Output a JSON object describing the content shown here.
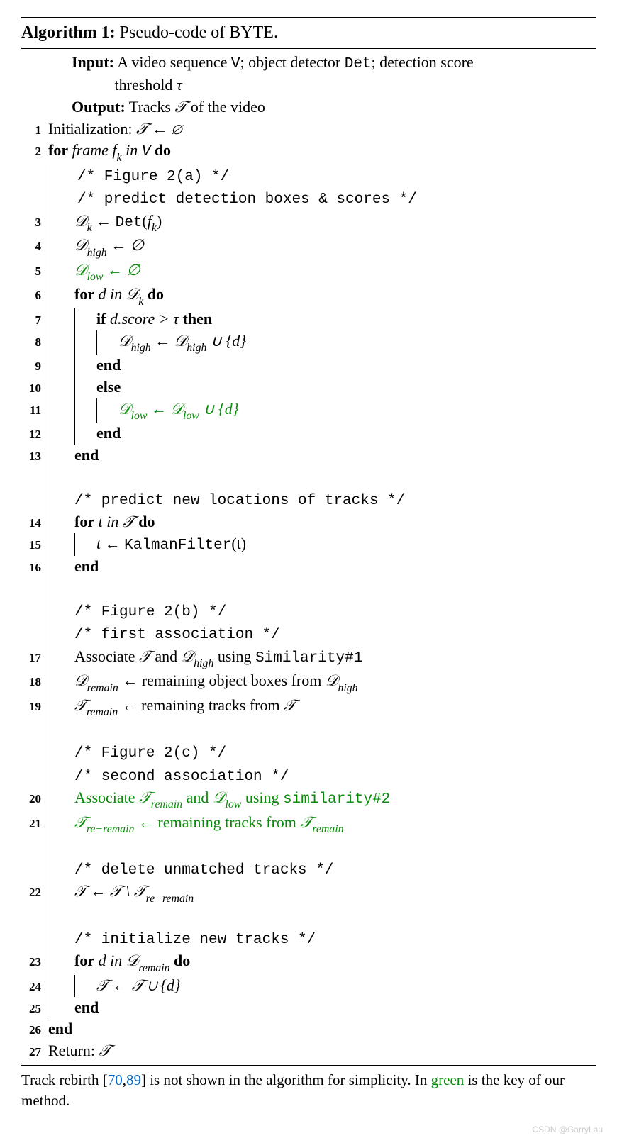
{
  "title_prefix": "Algorithm 1:",
  "title_text": " Pseudo-code of BYTE.",
  "input_label": "Input:",
  "input_text_1": " A video sequence ",
  "input_v": "V",
  "input_text_2": "; object detector ",
  "input_det": "Det",
  "input_text_3": "; detection score",
  "input_text_4": "threshold ",
  "input_tau": "τ",
  "output_label": "Output:",
  "output_text_1": " Tracks ",
  "output_T": "𝒯",
  "output_text_2": " of the video",
  "l1_text": "Initialization: ",
  "l1_assign": "𝒯 ← ∅",
  "l2_for": "for",
  "l2_frame": " frame f",
  "l2_k": "k",
  "l2_in": " in ",
  "l2_V": "V",
  "l2_do": " do",
  "c_fig2a": "/* Figure 2(a) */",
  "c_predict_boxes": "/* predict detection boxes & scores */",
  "l3_Dk": "𝒟",
  "l3_k": "k",
  "l3_arrow": " ← ",
  "l3_det": "Det",
  "l3_paren_open": "(",
  "l3_f": "f",
  "l3_fk": "k",
  "l3_paren_close": ")",
  "l4_Dhigh": "𝒟",
  "l4_high": "high",
  "l4_rest": " ← ∅",
  "l5_Dlow": "𝒟",
  "l5_low": "low",
  "l5_rest": " ← ∅",
  "l6_for": "for",
  "l6_d": " d ",
  "l6_in": "in",
  "l6_Dk": " 𝒟",
  "l6_k": "k",
  "l6_do": " do",
  "l7_if": "if",
  "l7_cond": " d.score > τ ",
  "l7_then": "then",
  "l8_Dhigh1": "𝒟",
  "l8_high1": "high",
  "l8_arrow": " ← ",
  "l8_Dhigh2": "𝒟",
  "l8_high2": "high",
  "l8_union": " ∪ {d}",
  "l9_end": "end",
  "l10_else": "else",
  "l11_Dlow1": "𝒟",
  "l11_low1": "low",
  "l11_arrow": " ← ",
  "l11_Dlow2": "𝒟",
  "l11_low2": "low",
  "l11_union": " ∪ {d}",
  "l12_end": "end",
  "l13_end": "end",
  "c_predict_loc": "/* predict new locations of tracks */",
  "l14_for": "for",
  "l14_t": " t ",
  "l14_in": "in",
  "l14_T": " 𝒯 ",
  "l14_do": "do",
  "l15_t": "t ← ",
  "l15_kf": "KalmanFilter",
  "l15_paren": "(t)",
  "l16_end": "end",
  "c_fig2b": "/* Figure 2(b) */",
  "c_first_assoc": "/* first association */",
  "l17_text1": "Associate ",
  "l17_T": "𝒯",
  "l17_and": " and ",
  "l17_D": "𝒟",
  "l17_high": "high",
  "l17_using": " using ",
  "l17_sim": "Similarity#1",
  "l18_D": "𝒟",
  "l18_remain": "remain",
  "l18_arrow": " ← remaining object boxes from ",
  "l18_D2": "𝒟",
  "l18_high": "high",
  "l19_T": "𝒯",
  "l19_remain": "remain",
  "l19_arrow": " ← remaining tracks from ",
  "l19_T2": "𝒯",
  "c_fig2c": "/* Figure 2(c) */",
  "c_second_assoc": "/* second association */",
  "l20_text1": "Associate ",
  "l20_T": "𝒯",
  "l20_remain": "remain",
  "l20_and": " and ",
  "l20_D": "𝒟",
  "l20_low": "low",
  "l20_using": " using ",
  "l20_sim": "similarity#2",
  "l21_T": "𝒯",
  "l21_reremain": "re−remain",
  "l21_arrow": " ← remaining tracks from ",
  "l21_T2": "𝒯",
  "l21_remain2": "remain",
  "c_delete": "/* delete unmatched tracks */",
  "l22_T1": "𝒯 ← 𝒯 \\ 𝒯",
  "l22_reremain": "re−remain",
  "c_init": "/* initialize new tracks */",
  "l23_for": "for",
  "l23_d": " d ",
  "l23_in": "in",
  "l23_D": " 𝒟",
  "l23_remain": "remain",
  "l23_do": " do",
  "l24_text": "𝒯 ← 𝒯 ∪ {d}",
  "l25_end": "end",
  "l26_end": "end",
  "l27_return": "Return: ",
  "l27_T": "𝒯",
  "footer_1": "Track rebirth [",
  "footer_ref1": "70",
  "footer_comma": ",",
  "footer_ref2": "89",
  "footer_2": "] is not shown in the algorithm for simplicity. In ",
  "footer_green": "green",
  "footer_3": " is the key of our method.",
  "watermark": "CSDN @GarryLau"
}
